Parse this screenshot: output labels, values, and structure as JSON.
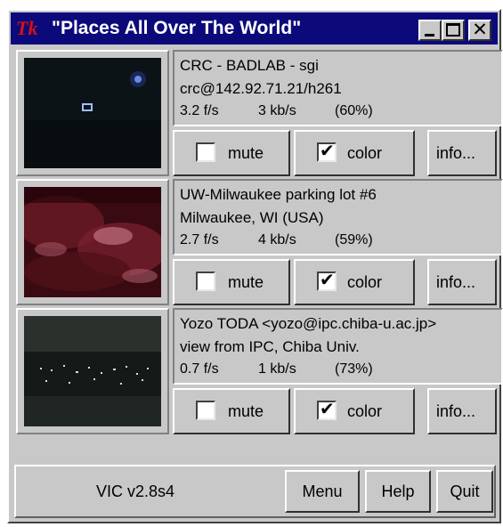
{
  "window": {
    "logo": "Tk",
    "title": "\"Places All Over The World\"",
    "minimize_icon": "minimize-icon",
    "maximize_icon": "maximize-icon",
    "close_icon": "close-icon",
    "close_glyph": "✕"
  },
  "sources": [
    {
      "name": "CRC - BADLAB - sgi",
      "address": "crc@142.92.71.21/h261",
      "fps": "3.2 f/s",
      "bitrate": "3 kb/s",
      "quality": "(60%)",
      "mute_label": "mute",
      "mute_checked": false,
      "color_label": "color",
      "color_checked": true,
      "info_label": "info..."
    },
    {
      "name": "UW-Milwaukee parking lot #6",
      "address": "Milwaukee, WI  (USA)",
      "fps": "2.7 f/s",
      "bitrate": "4 kb/s",
      "quality": "(59%)",
      "mute_label": "mute",
      "mute_checked": false,
      "color_label": "color",
      "color_checked": true,
      "info_label": "info..."
    },
    {
      "name": "Yozo TODA <yozo@ipc.chiba-u.ac.jp>",
      "address": "view from IPC, Chiba Univ.",
      "fps": "0.7 f/s",
      "bitrate": "1 kb/s",
      "quality": "(73%)",
      "mute_label": "mute",
      "mute_checked": false,
      "color_label": "color",
      "color_checked": true,
      "info_label": "info..."
    }
  ],
  "footer": {
    "version": "VIC v2.8s4",
    "menu_label": "Menu",
    "help_label": "Help",
    "quit_label": "Quit"
  },
  "colors": {
    "titlebar": "#0c0a7a",
    "panel": "#c8c8c8",
    "logo": "#d81010"
  },
  "check_glyph": "✔"
}
